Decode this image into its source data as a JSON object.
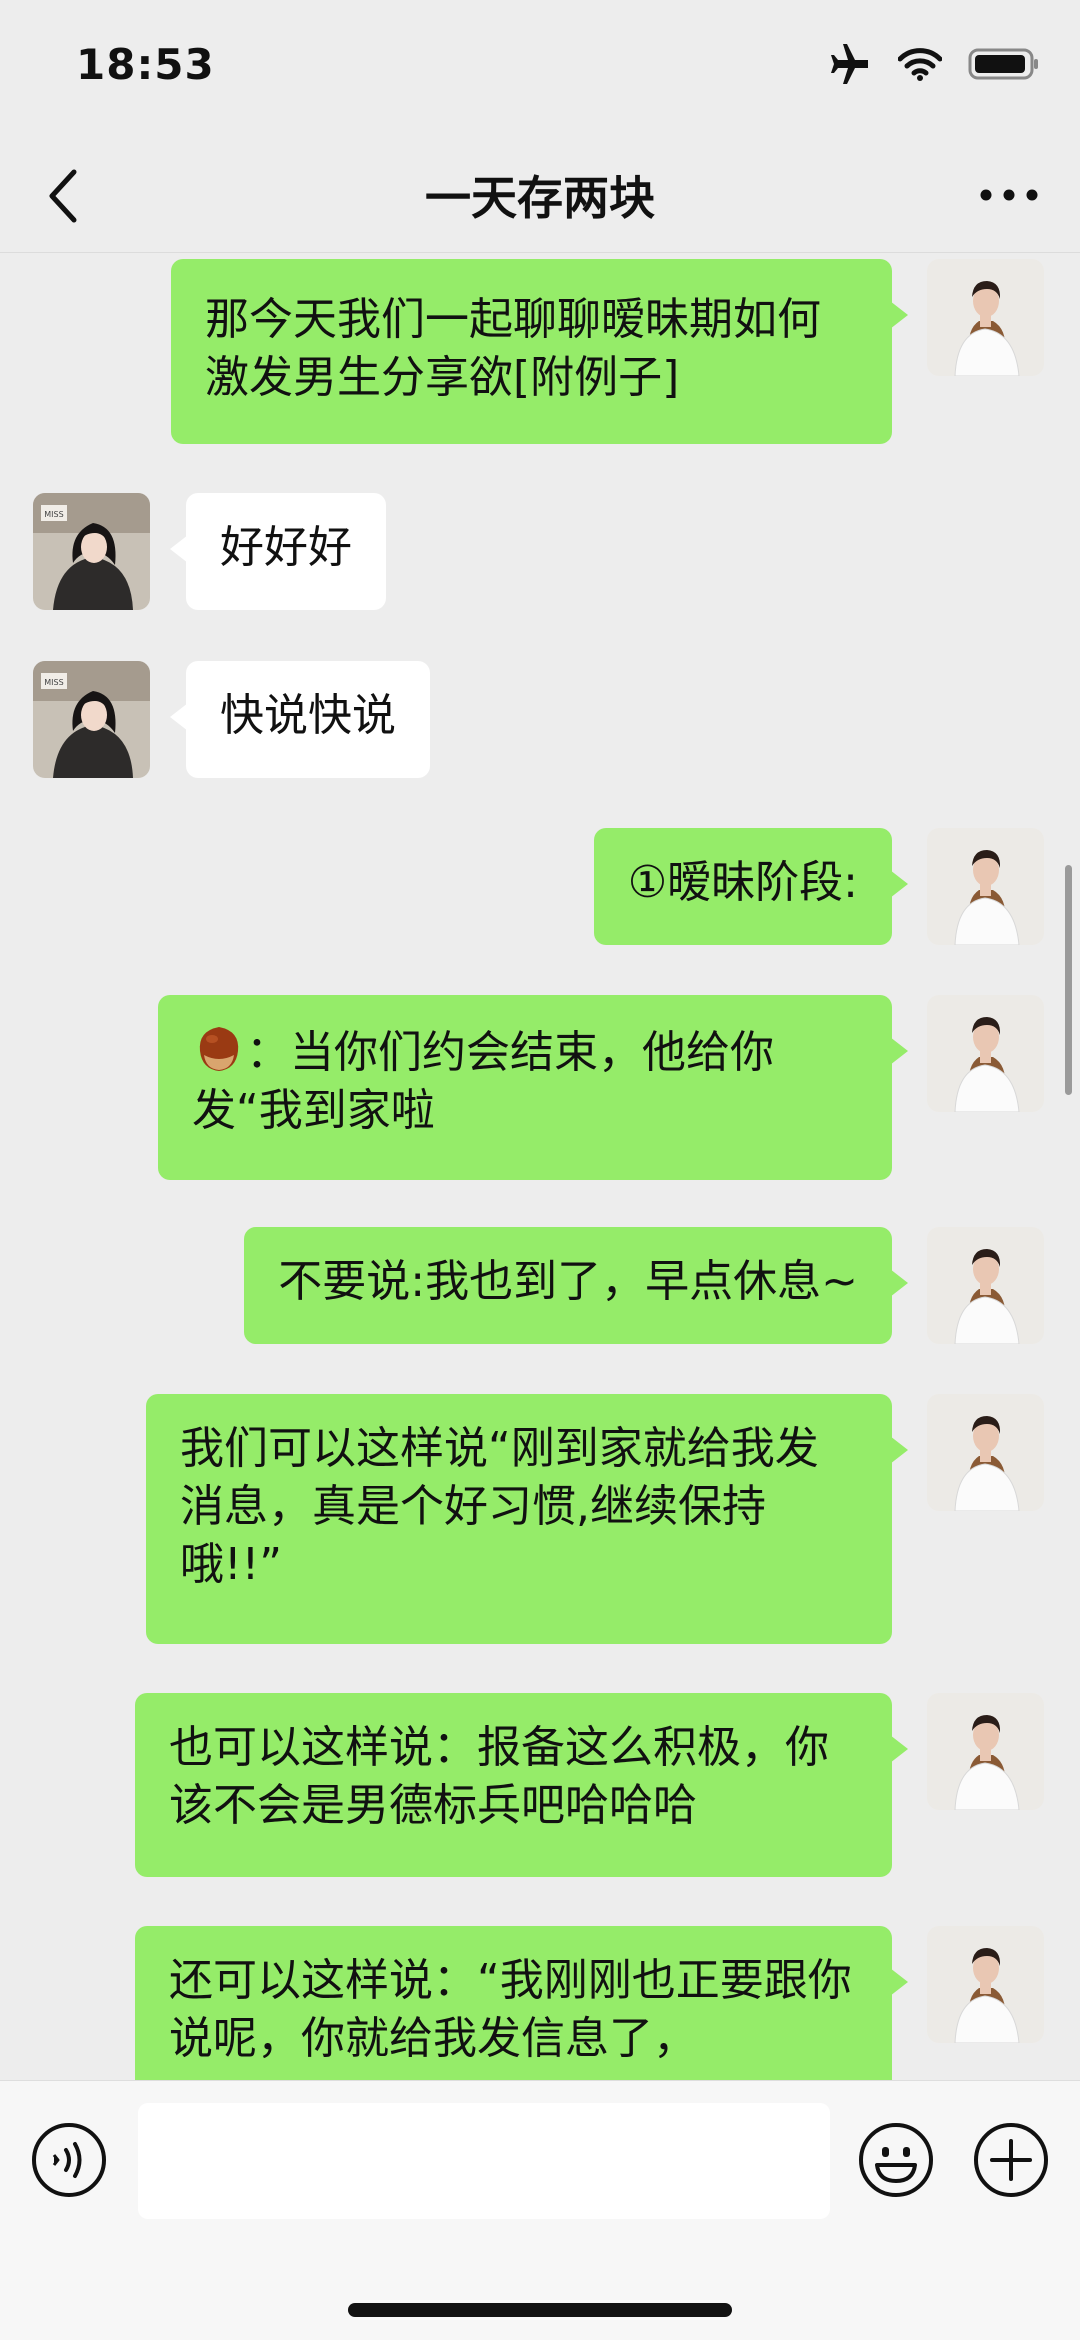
{
  "status_bar": {
    "time": "18:53"
  },
  "nav": {
    "title": "一天存两块"
  },
  "messages": [
    {
      "sender": "me",
      "text": "那今天我们一起聊聊暧昧期如何激发男生分享欲[附例子]"
    },
    {
      "sender": "other",
      "text": "好好好"
    },
    {
      "sender": "other",
      "text": "快说快说"
    },
    {
      "sender": "me",
      "text": "①暧昧阶段:"
    },
    {
      "sender": "me",
      "text": "：当你们约会结束，他给你发“我到家啦",
      "emoji": "chestnut"
    },
    {
      "sender": "me",
      "text": "不要说:我也到了，早点休息~"
    },
    {
      "sender": "me",
      "text": "我们可以这样说“刚到家就给我发消息，真是个好习惯,继续保持哦!!”"
    },
    {
      "sender": "me",
      "text": "也可以这样说：报备这么积极，你该不会是男德标兵吧哈哈哈"
    },
    {
      "sender": "me",
      "text": "还可以这样说：“我刚刚也正要跟你说呢，你就给我发信息了，"
    }
  ],
  "input": {
    "placeholder": ""
  },
  "icons": {
    "back": "chevron-left-icon",
    "more": "more-dots-icon",
    "voice": "voice-icon",
    "emoji": "emoji-icon",
    "plus": "plus-icon"
  },
  "colors": {
    "my_bubble": "#95ec69",
    "other_bubble": "#ffffff",
    "background": "#ededed"
  }
}
